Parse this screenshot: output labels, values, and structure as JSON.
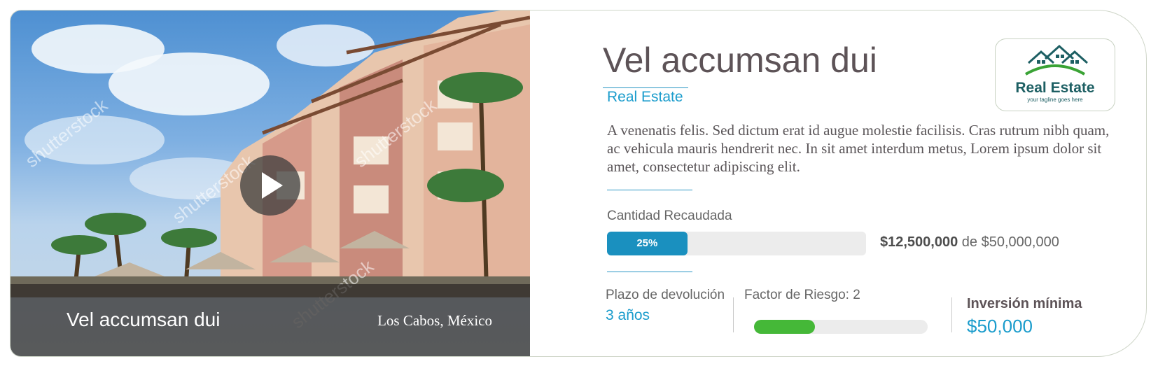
{
  "photo": {
    "title": "Vel accumsan dui",
    "location": "Los Cabos, México",
    "watermark": "shutterstock"
  },
  "header": {
    "title": "Vel accumsan dui",
    "category": "Real Estate"
  },
  "logo": {
    "name": "Real Estate",
    "tagline": "your tagline goes here"
  },
  "description": "A venenatis felis. Sed dictum erat id augue molestie facilisis. Cras rutrum nibh quam, ac vehicula mauris hendrerit nec. In sit amet interdum metus, Lorem ipsum dolor sit amet, consectetur adipiscing elit.",
  "funding": {
    "label": "Cantidad Recaudada",
    "progress_percent": 25,
    "progress_label": "25%",
    "raised": "$12,500,000",
    "goal_text": "de $50,000,000"
  },
  "stats": {
    "term_label": "Plazo de devolución",
    "term_value": "3 años",
    "risk_label": "Factor de Riesgo: 2",
    "risk_level_fraction": 0.35,
    "min_label": "Inversión mínima",
    "min_value": "$50,000"
  },
  "colors": {
    "accent": "#1a9ccc",
    "progress": "#1a90bf",
    "risk": "#45b838"
  }
}
